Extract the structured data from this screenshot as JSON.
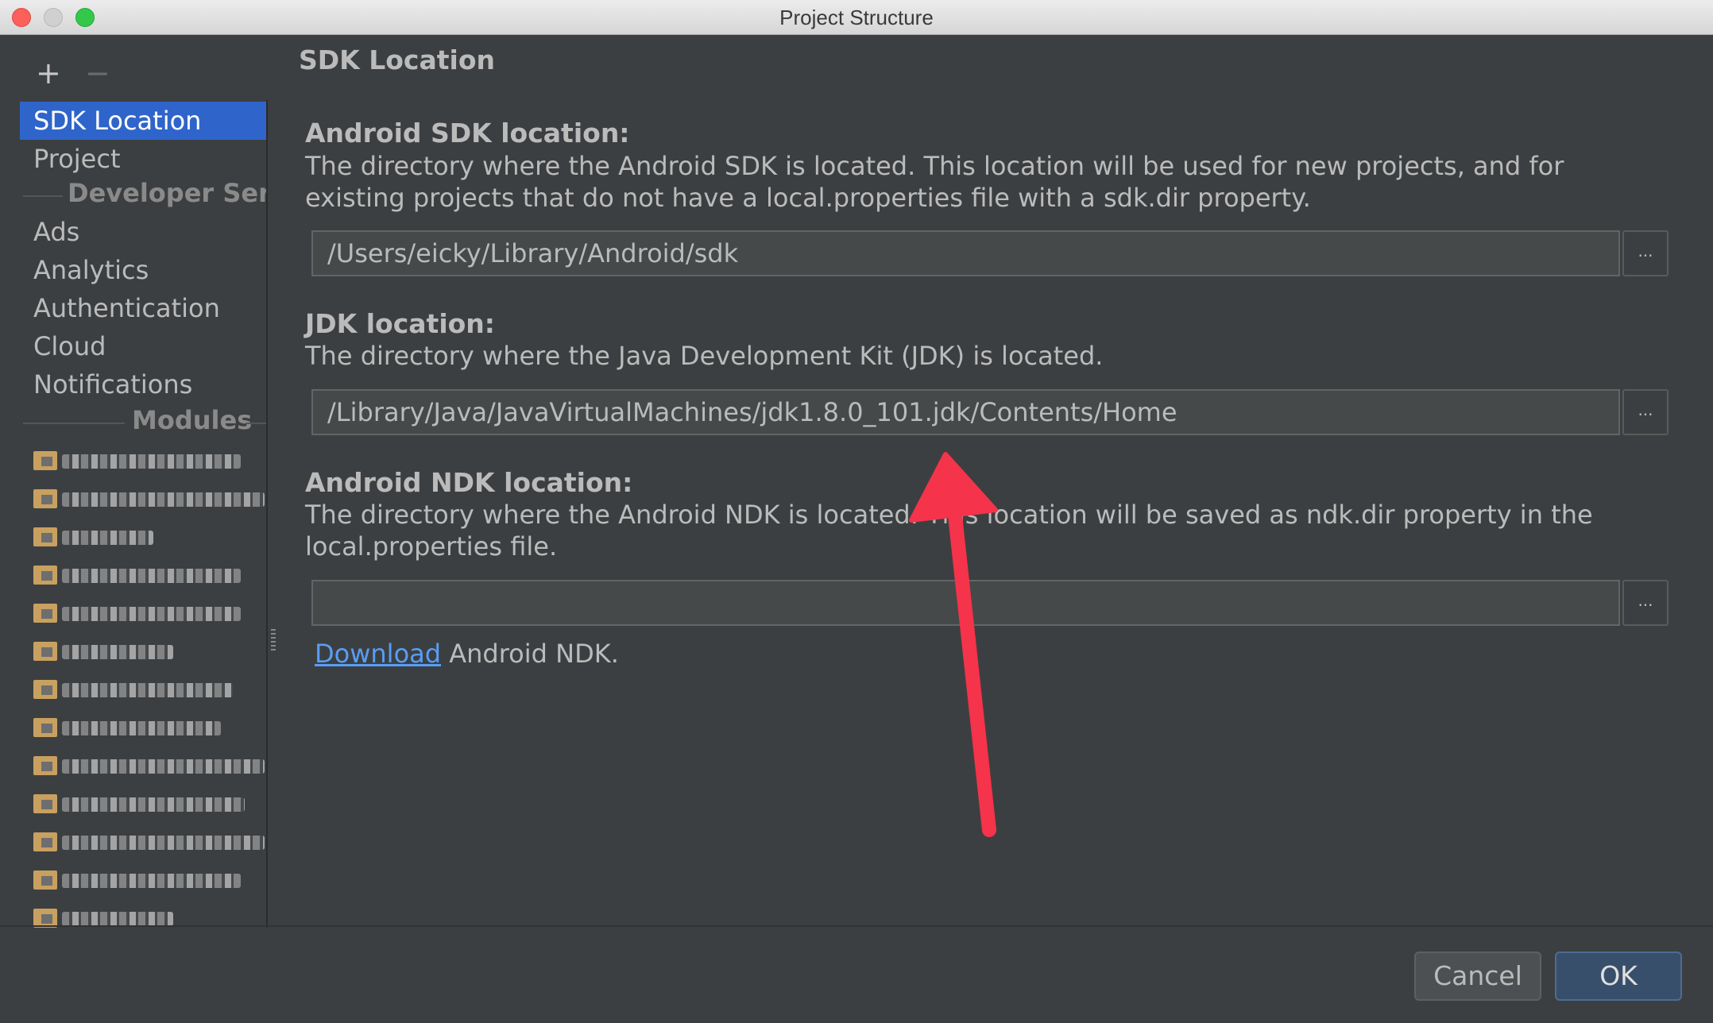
{
  "window": {
    "title": "Project Structure"
  },
  "toolbar": {
    "add_label": "+",
    "remove_label": "−"
  },
  "sidebar": {
    "items": [
      {
        "label": "SDK Location",
        "selected": true
      },
      {
        "label": "Project"
      }
    ],
    "section_developer": "Developer Servi",
    "dev_items": [
      {
        "label": "Ads"
      },
      {
        "label": "Analytics"
      },
      {
        "label": "Authentication"
      },
      {
        "label": "Cloud"
      },
      {
        "label": "Notifications"
      }
    ],
    "section_modules": "Modules",
    "module_count_visible": 13
  },
  "main": {
    "page_title": "SDK Location",
    "android_sdk": {
      "heading": "Android SDK location:",
      "description": "The directory where the Android SDK is located. This location will be used for new projects, and for existing projects that do not have a local.properties file with a sdk.dir property.",
      "value": "/Users/eicky/Library/Android/sdk",
      "browse_label": "..."
    },
    "jdk": {
      "heading": "JDK location:",
      "description": "The directory where the Java Development Kit (JDK) is located.",
      "value": "/Library/Java/JavaVirtualMachines/jdk1.8.0_101.jdk/Contents/Home",
      "browse_label": "..."
    },
    "android_ndk": {
      "heading": "Android NDK location:",
      "description": "The directory where the Android NDK is located. This location will be saved as ndk.dir property in the local.properties file.",
      "value": "",
      "browse_label": "...",
      "download_link": "Download",
      "download_suffix": " Android NDK."
    }
  },
  "footer": {
    "cancel_label": "Cancel",
    "ok_label": "OK"
  },
  "colors": {
    "background": "#3c3f41",
    "selection": "#2f65ca",
    "link": "#589df6",
    "annotation_arrow": "#f5334a"
  }
}
